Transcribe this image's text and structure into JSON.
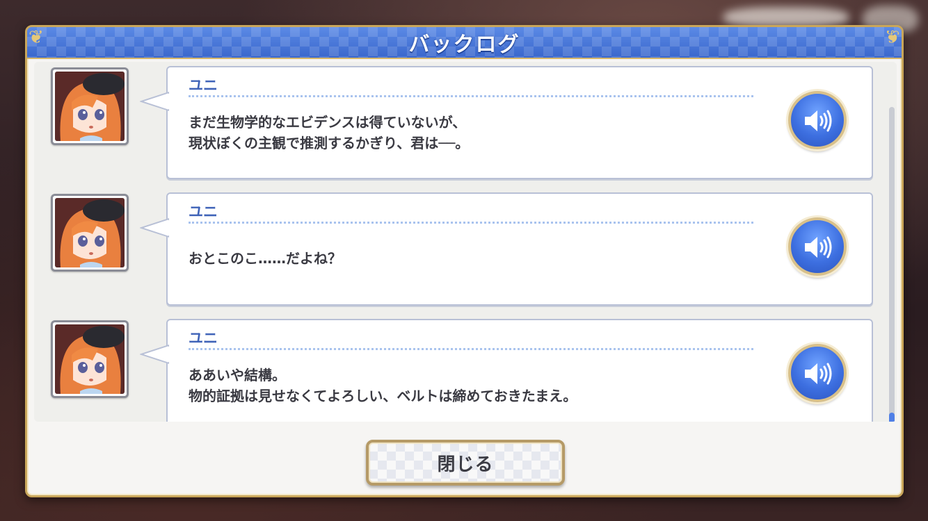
{
  "title": "バックログ",
  "entries": [
    {
      "speaker": "ユニ",
      "text": "まだ生物学的なエビデンスは得ていないが、\n現状ぼくの主観で推測するかぎり、君は──。"
    },
    {
      "speaker": "ユニ",
      "text": "おとこのこ……だよね？"
    },
    {
      "speaker": "ユニ",
      "text": "ああいや結構。\n物的証拠は見せなくてよろしい、ベルトは締めておきたまえ。"
    }
  ],
  "close_label": "閉じる",
  "icons": {
    "voice": "speaker-icon",
    "portrait": "character-portrait"
  },
  "colors": {
    "title_bar": "#3f70d4",
    "speaker_name": "#3f63b8",
    "voice_button": "#3d6fe0",
    "frame_gold": "#c9a65a",
    "scroll_thumb": "#4f7fe6"
  },
  "scroll": {
    "position": "bottom"
  }
}
